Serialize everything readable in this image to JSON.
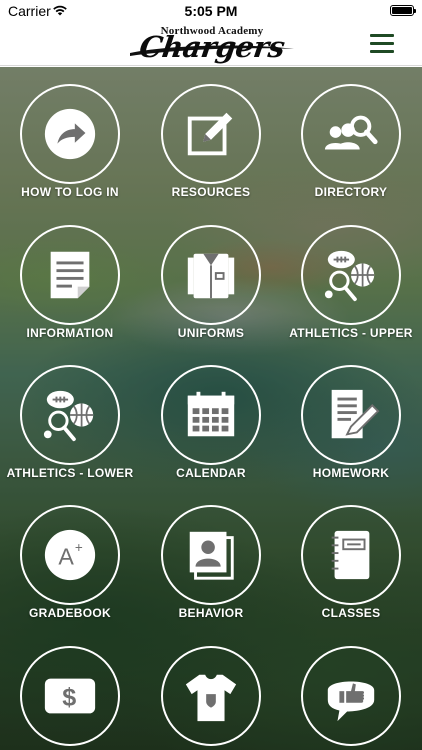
{
  "status_bar": {
    "carrier": "Carrier",
    "time": "5:05 PM"
  },
  "header": {
    "school_name": "Northwood Academy",
    "mascot": "Chargers",
    "menu_icon": "hamburger-menu-icon"
  },
  "tiles": [
    {
      "label": "HOW TO LOG IN",
      "icon": "share-arrow-icon"
    },
    {
      "label": "RESOURCES",
      "icon": "pencil-edit-icon"
    },
    {
      "label": "DIRECTORY",
      "icon": "people-search-icon"
    },
    {
      "label": "INFORMATION",
      "icon": "document-icon"
    },
    {
      "label": "UNIFORMS",
      "icon": "shirt-icon"
    },
    {
      "label": "ATHLETICS - UPPER",
      "icon": "sports-balls-icon"
    },
    {
      "label": "ATHLETICS - LOWER",
      "icon": "sports-balls-icon"
    },
    {
      "label": "CALENDAR",
      "icon": "calendar-icon"
    },
    {
      "label": "HOMEWORK",
      "icon": "homework-icon"
    },
    {
      "label": "GRADEBOOK",
      "icon": "grade-a-plus-icon"
    },
    {
      "label": "BEHAVIOR",
      "icon": "portrait-icon"
    },
    {
      "label": "CLASSES",
      "icon": "notebook-icon"
    },
    {
      "label": "",
      "icon": "dollar-icon"
    },
    {
      "label": "",
      "icon": "tshirt-icon"
    },
    {
      "label": "",
      "icon": "thumbs-up-icon"
    }
  ]
}
